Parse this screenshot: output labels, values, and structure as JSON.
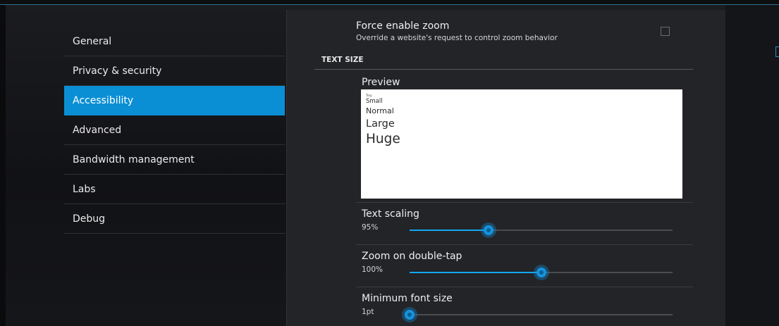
{
  "sidebar": {
    "items": [
      {
        "label": "General"
      },
      {
        "label": "Privacy & security"
      },
      {
        "label": "Accessibility",
        "selected": true
      },
      {
        "label": "Advanced"
      },
      {
        "label": "Bandwidth management"
      },
      {
        "label": "Labs"
      },
      {
        "label": "Debug"
      }
    ]
  },
  "force_zoom": {
    "title": "Force enable zoom",
    "subtitle": "Override a website's request to control zoom behavior",
    "checked": false
  },
  "text_size": {
    "header": "TEXT SIZE",
    "preview_label": "Preview",
    "preview_samples": [
      "Tiny",
      "Small",
      "Normal",
      "Large",
      "Huge"
    ]
  },
  "text_scaling": {
    "title": "Text scaling",
    "value": "95%",
    "fraction": 0.3
  },
  "zoom_double_tap": {
    "title": "Zoom on double-tap",
    "value": "100%",
    "fraction": 0.5
  },
  "min_font_size": {
    "title": "Minimum font size",
    "value": "1pt",
    "fraction": 0.0
  },
  "colors": {
    "accent": "#0b8fd4",
    "slider_fill": "#11a8f0",
    "panel_bg": "#232428"
  }
}
